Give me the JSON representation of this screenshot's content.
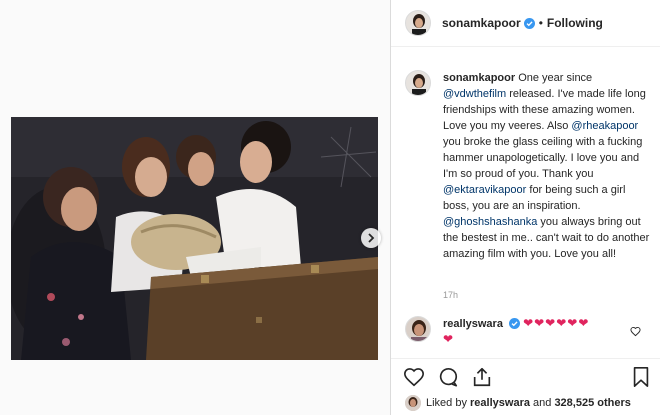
{
  "post": {
    "username": "sonamkapoor",
    "dot": "•",
    "follow_status": "Following"
  },
  "caption": {
    "username": "sonamkapoor",
    "segments": [
      {
        "type": "text",
        "text": " One year since "
      },
      {
        "type": "mention",
        "text": "@vdwthefilm"
      },
      {
        "type": "text",
        "text": " released. I've made life long friendships with these amazing women. Love you my veeres. Also "
      },
      {
        "type": "mention",
        "text": "@rheakapoor"
      },
      {
        "type": "text",
        "text": " you broke the glass ceiling with a fucking hammer unapologetically. I love you and I'm so proud of you. Thank you "
      },
      {
        "type": "mention",
        "text": "@ektaravikapoor"
      },
      {
        "type": "text",
        "text": " for being such a girl boss, you are an inspiration. "
      },
      {
        "type": "mention",
        "text": "@ghoshshashanka"
      },
      {
        "type": "text",
        "text": " you always bring out the bestest in me.. can't wait to do another amazing film with you. Love you all!"
      }
    ],
    "time": "17h"
  },
  "comment": {
    "username": "reallyswara",
    "hearts": "❤❤❤❤❤❤",
    "hearts_second_line": "❤"
  },
  "likes": {
    "prefix": "Liked by ",
    "user": "reallyswara",
    "middle": " and ",
    "count": "328,525 others"
  },
  "icons": {
    "verified": "verified-badge-icon",
    "next": "chevron-right-icon",
    "like": "heart-outline-icon",
    "comment": "comment-bubble-icon",
    "share": "share-icon",
    "save": "bookmark-icon"
  },
  "colors": {
    "mention": "#003569",
    "verified": "#3897f0",
    "heart": "#e0245e"
  }
}
